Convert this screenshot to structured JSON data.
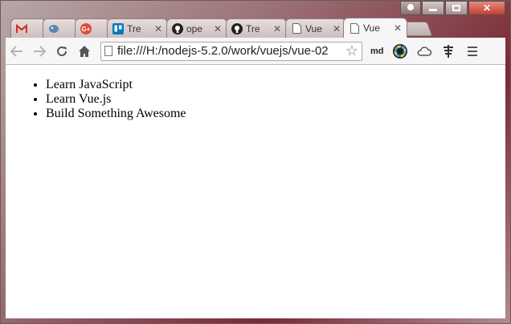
{
  "browser": {
    "tabs": [
      {
        "title": "",
        "favicon": "gmail-icon",
        "close": ""
      },
      {
        "title": "",
        "favicon": "bird-icon",
        "close": ""
      },
      {
        "title": "",
        "favicon": "google-plus-icon",
        "close": ""
      },
      {
        "title": "Tre",
        "favicon": "trello-icon",
        "close": "✕"
      },
      {
        "title": "ope",
        "favicon": "github-icon",
        "close": "✕"
      },
      {
        "title": "Tre",
        "favicon": "github-icon",
        "close": "✕"
      },
      {
        "title": "Vue",
        "favicon": "page-icon",
        "close": "✕"
      },
      {
        "title": "Vue",
        "favicon": "page-icon",
        "close": "✕",
        "active": true
      }
    ],
    "address_bar": {
      "url": "file:///H:/nodejs-5.2.0/work/vuejs/vue-02"
    },
    "extension_label": "md",
    "icons": {
      "back": "back-arrow-icon",
      "forward": "forward-arrow-icon",
      "reload": "reload-icon",
      "home": "home-icon",
      "bookmark": "star-icon",
      "menu": "hamburger-menu-icon"
    }
  },
  "page": {
    "list_items": [
      "Learn JavaScript",
      "Learn Vue.js",
      "Build Something Awesome"
    ]
  },
  "colors": {
    "accent_close": "#c2402e",
    "page_bg": "#ffffff"
  }
}
